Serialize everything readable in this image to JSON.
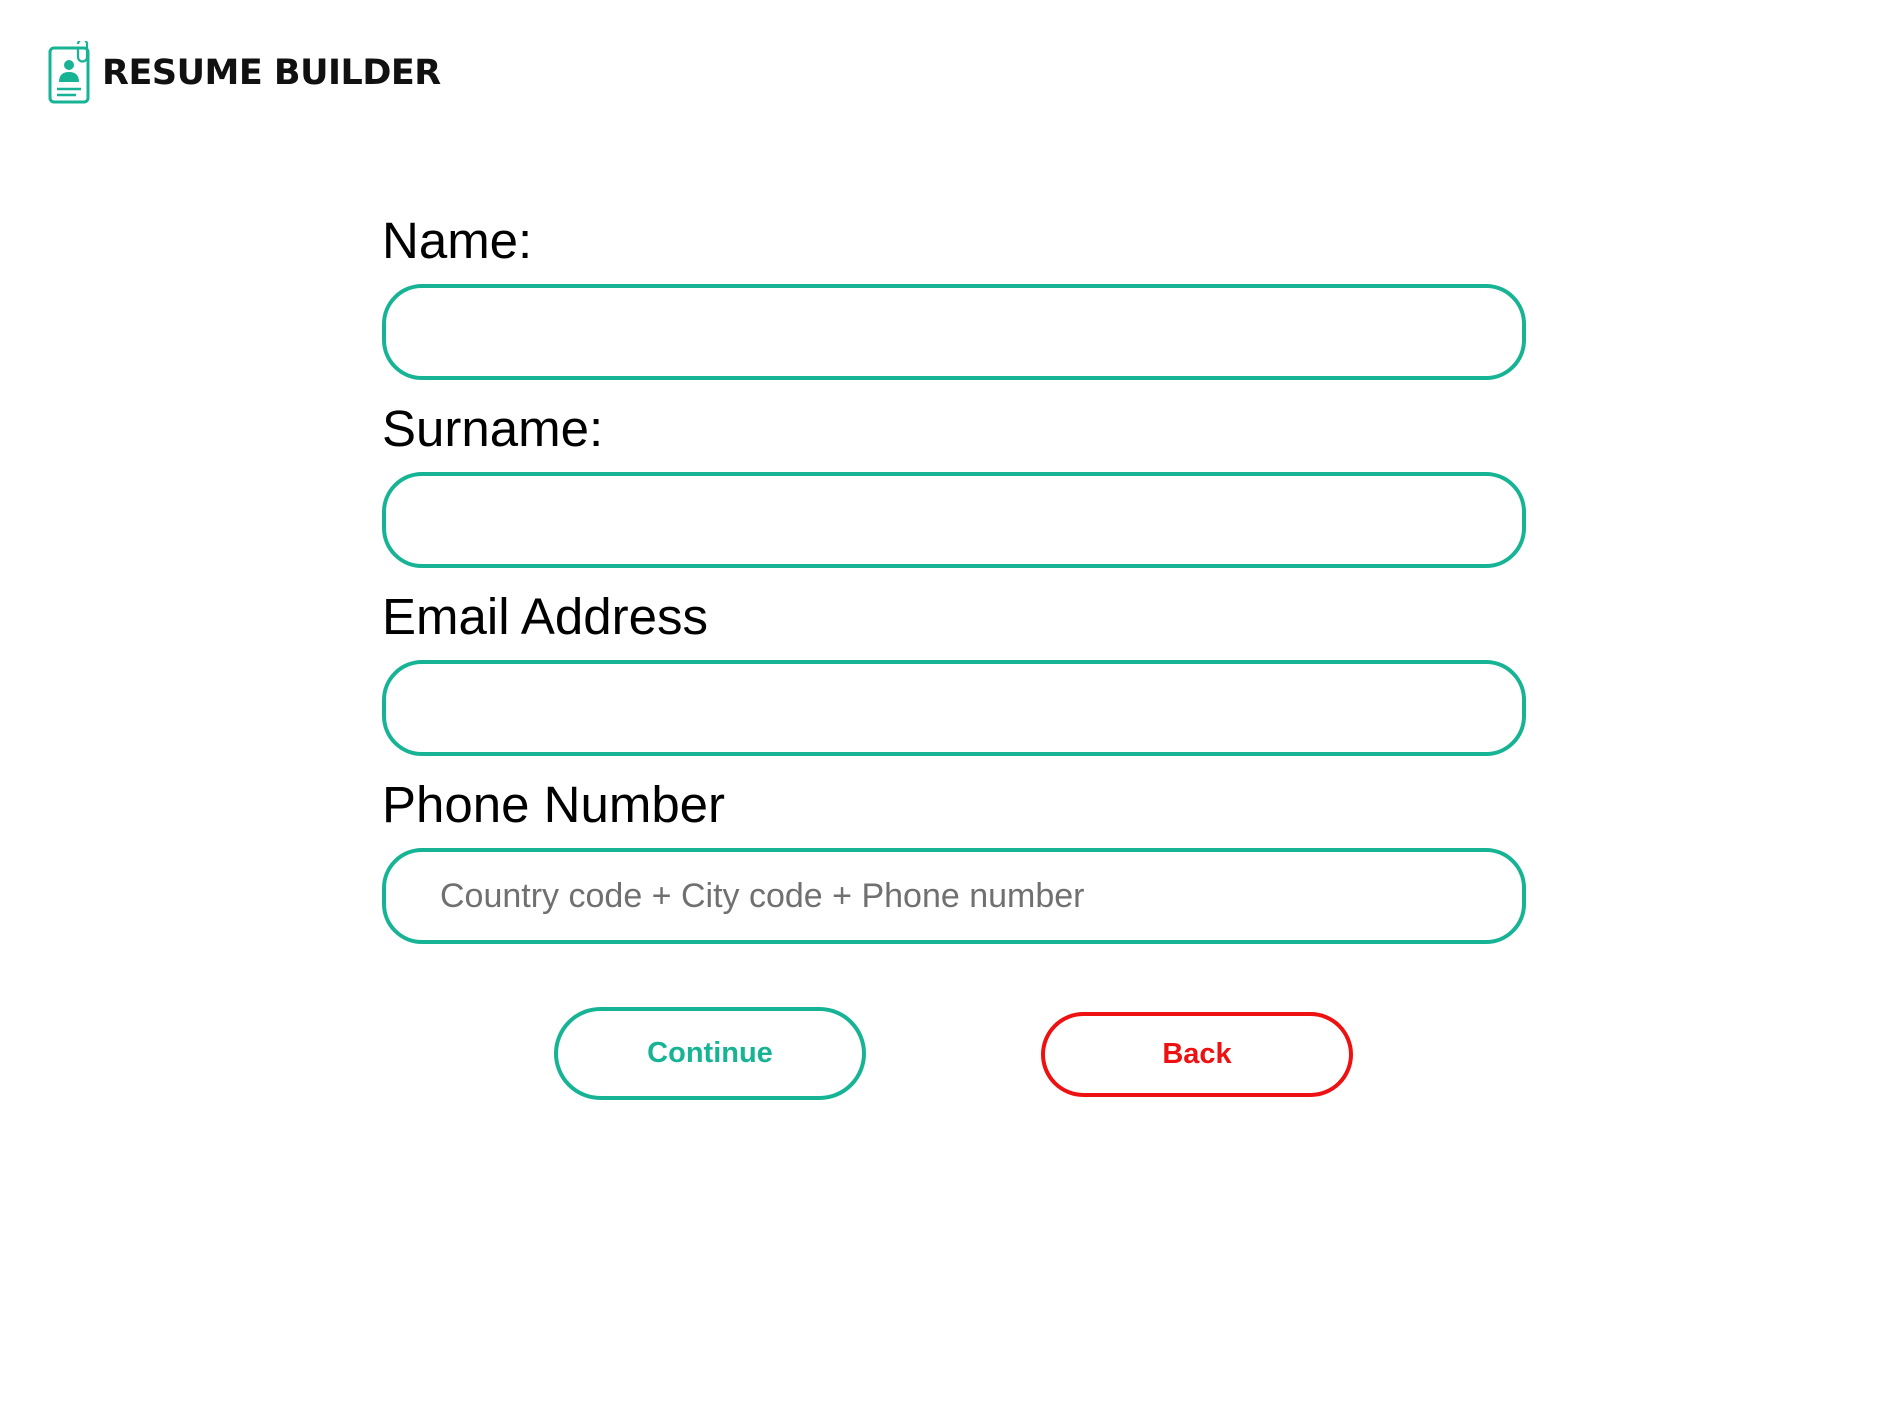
{
  "app": {
    "brand": "RESUME BUILDER",
    "logo_icon": "resume-id-card-icon"
  },
  "form": {
    "fields": [
      {
        "label": "Name:",
        "value": "",
        "placeholder": ""
      },
      {
        "label": "Surname:",
        "value": "",
        "placeholder": ""
      },
      {
        "label": "Email Address",
        "value": "",
        "placeholder": ""
      },
      {
        "label": "Phone Number",
        "value": "",
        "placeholder": "Country code + City code + Phone number"
      }
    ]
  },
  "buttons": {
    "continue_label": "Continue",
    "back_label": "Back"
  },
  "colors": {
    "accent": "#17b395",
    "danger": "#ee1111",
    "text": "#000000",
    "placeholder": "#707070"
  }
}
